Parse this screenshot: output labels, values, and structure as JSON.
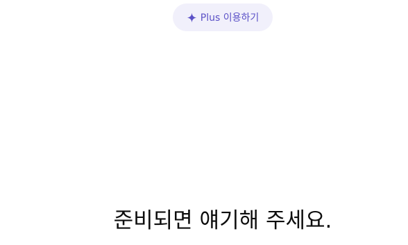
{
  "header": {
    "upgrade_button": {
      "icon": "sparkle-icon",
      "label": "Plus 이용하기",
      "accent_color": "#5b51c7",
      "background_color": "#f1f0fb"
    }
  },
  "main": {
    "heading": "준비되면 얘기해 주세요."
  }
}
